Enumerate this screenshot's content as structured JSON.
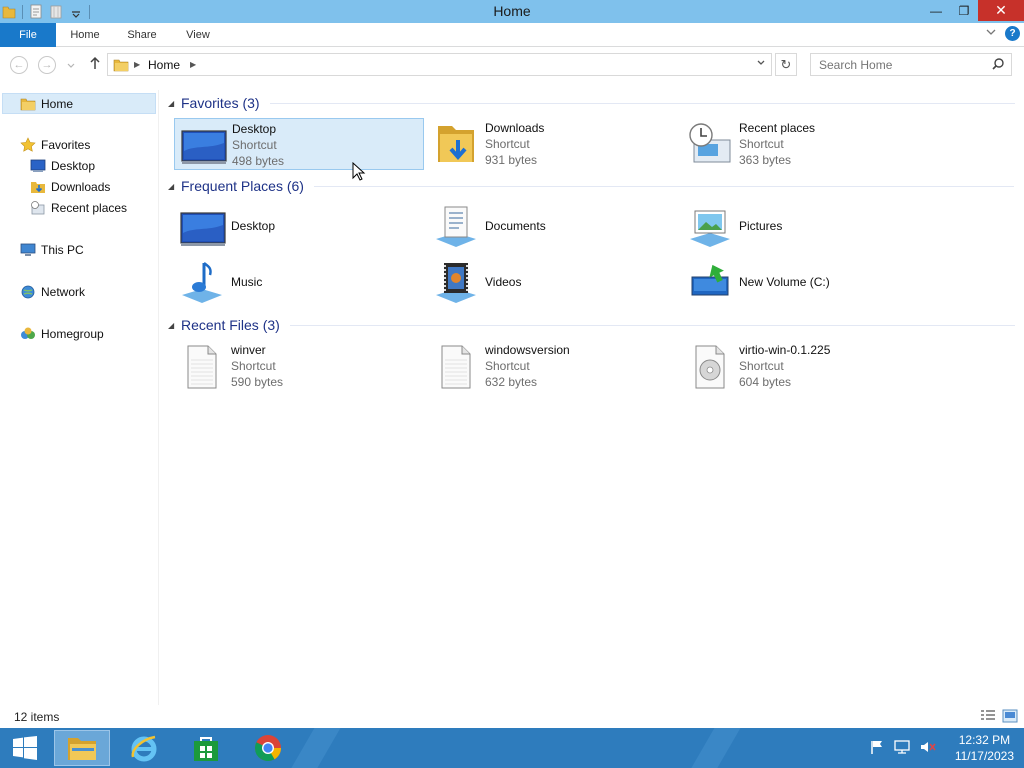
{
  "window": {
    "title": "Home",
    "controls": {
      "minimize": "—",
      "maximize": "❐",
      "close": "✕"
    }
  },
  "ribbon": {
    "tabs": [
      "File",
      "Home",
      "Share",
      "View"
    ]
  },
  "address": {
    "crumb": "Home",
    "search_placeholder": "Search Home"
  },
  "nav": {
    "home": "Home",
    "favorites": "Favorites",
    "fav_items": [
      "Desktop",
      "Downloads",
      "Recent places"
    ],
    "this_pc": "This PC",
    "network": "Network",
    "homegroup": "Homegroup"
  },
  "groups": {
    "favorites": {
      "title": "Favorites (3)",
      "items": [
        {
          "name": "Desktop",
          "type": "Shortcut",
          "size": "498 bytes",
          "icon": "desktop-icon"
        },
        {
          "name": "Downloads",
          "type": "Shortcut",
          "size": "931 bytes",
          "icon": "downloads-folder-icon"
        },
        {
          "name": "Recent places",
          "type": "Shortcut",
          "size": "363 bytes",
          "icon": "recent-places-icon"
        }
      ]
    },
    "frequent": {
      "title": "Frequent Places (6)",
      "items": [
        {
          "name": "Desktop",
          "icon": "desktop-icon"
        },
        {
          "name": "Documents",
          "icon": "documents-icon"
        },
        {
          "name": "Pictures",
          "icon": "pictures-icon"
        },
        {
          "name": "Music",
          "icon": "music-icon"
        },
        {
          "name": "Videos",
          "icon": "videos-icon"
        },
        {
          "name": "New Volume (C:)",
          "icon": "drive-icon"
        }
      ]
    },
    "recent": {
      "title": "Recent Files (3)",
      "items": [
        {
          "name": "winver",
          "type": "Shortcut",
          "size": "590 bytes",
          "icon": "file-icon"
        },
        {
          "name": "windowsversion",
          "type": "Shortcut",
          "size": "632 bytes",
          "icon": "file-icon"
        },
        {
          "name": "virtio-win-0.1.225",
          "type": "Shortcut",
          "size": "604 bytes",
          "icon": "disc-file-icon"
        }
      ]
    }
  },
  "status": {
    "count": "12 items"
  },
  "taskbar": {
    "time": "12:32 PM",
    "date": "11/17/2023"
  },
  "colors": {
    "titlebar": "#7fc1ec",
    "file_tab": "#1979ca",
    "taskbar": "#2e7cbd",
    "selection": "#d9ebf9",
    "group_title": "#1e3287"
  }
}
